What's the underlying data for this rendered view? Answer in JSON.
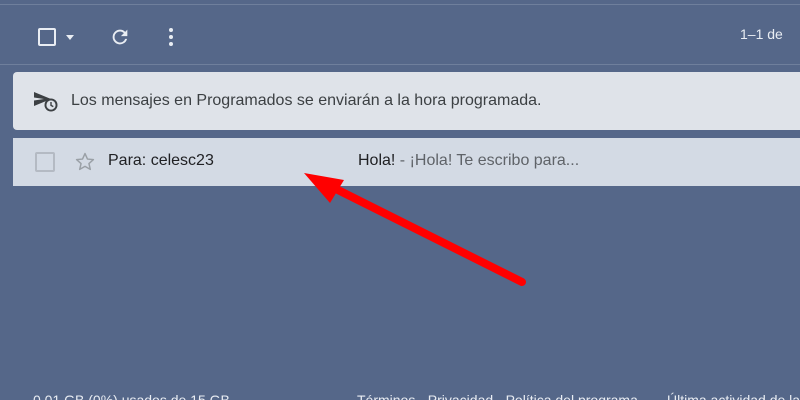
{
  "toolbar": {
    "select_all_icon": "checkbox-empty-icon",
    "select_menu_icon": "caret-down-icon",
    "refresh_icon": "refresh-icon",
    "more_icon": "more-vert-icon",
    "pagination": "1–1 de"
  },
  "banner": {
    "icon": "scheduled-send-icon",
    "text": "Los mensajes en Programados se enviarán a la hora programada."
  },
  "messages": [
    {
      "recipient": "Para: celesc23",
      "subject": "Hola!",
      "separator": " - ",
      "snippet": "¡Hola! Te escribo para..."
    }
  ],
  "annotation": {
    "type": "red-arrow",
    "color": "#ff0000"
  },
  "colors": {
    "background": "#556789",
    "banner_bg": "#dfe3e9",
    "row_bg": "#d3dae4"
  }
}
